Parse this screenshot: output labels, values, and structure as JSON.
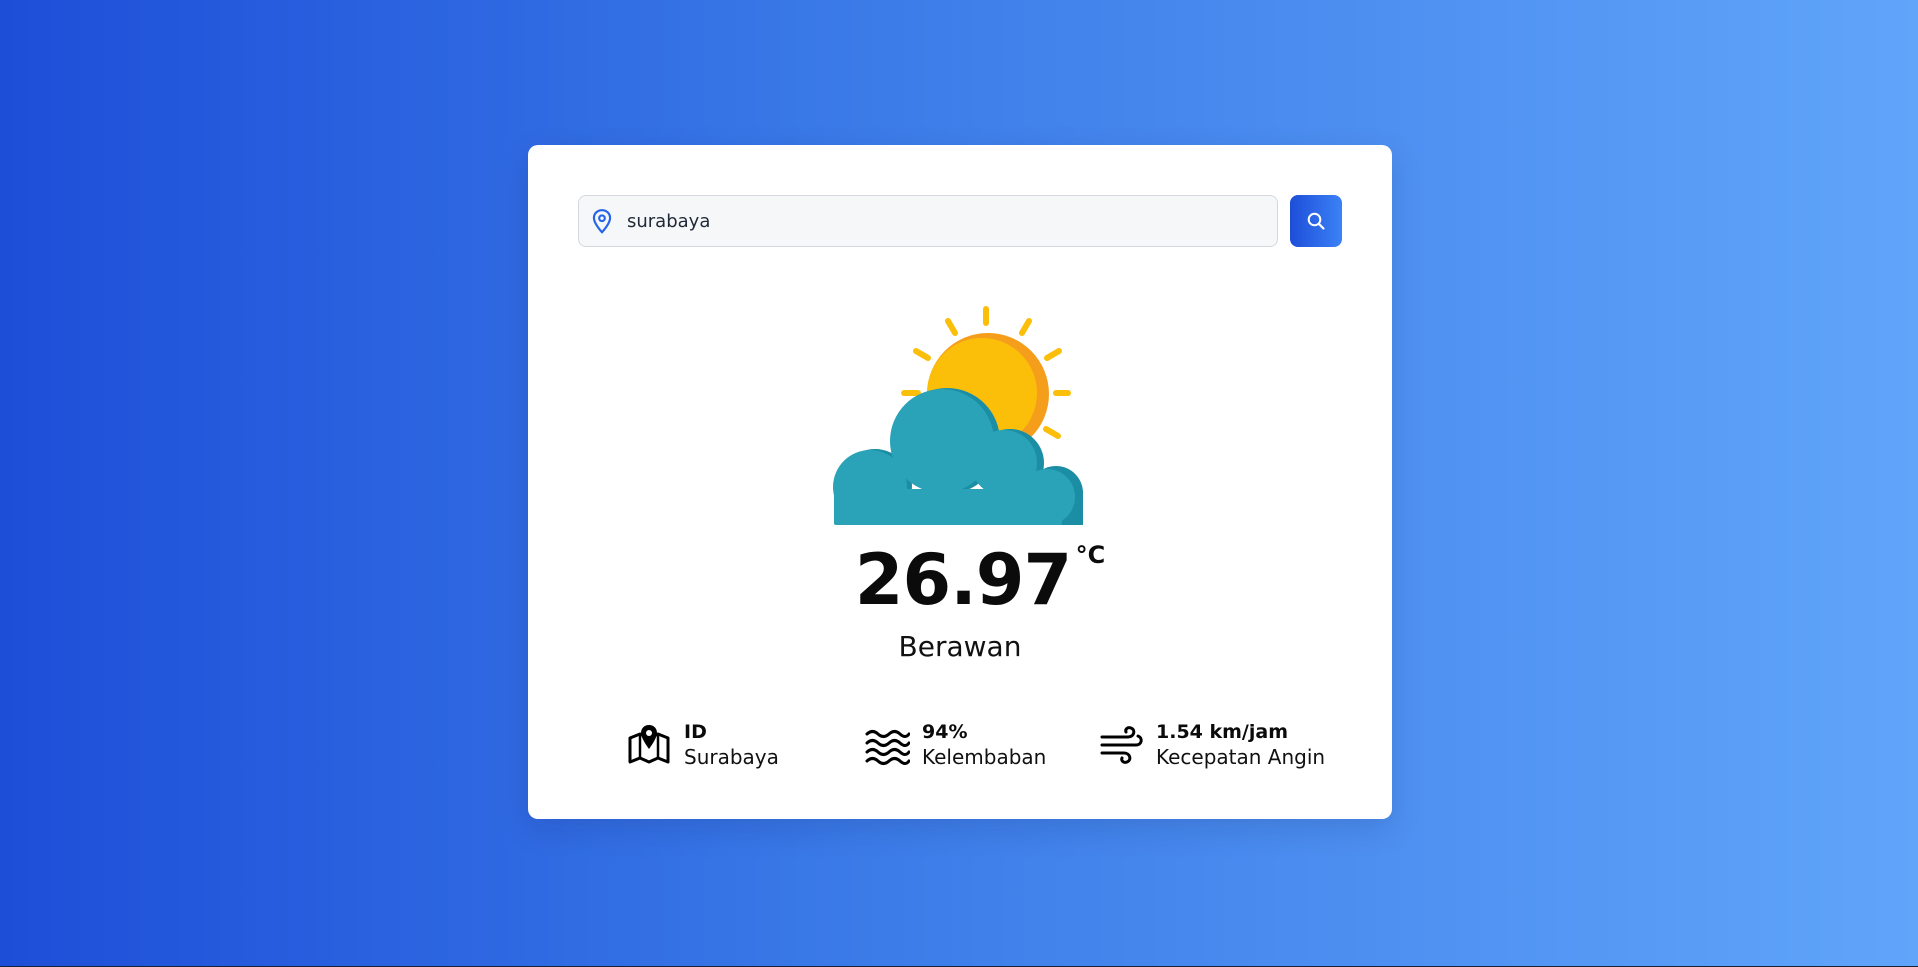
{
  "search": {
    "value": "surabaya",
    "placeholder": ""
  },
  "weather": {
    "temperature": "26.97",
    "unit": "°C",
    "condition": "Berawan",
    "icon": "partly-cloudy-icon"
  },
  "details": [
    {
      "icon": "map-icon",
      "value": "ID",
      "label": "Surabaya"
    },
    {
      "icon": "humidity-waves-icon",
      "value": "94%",
      "label": "Kelembaban"
    },
    {
      "icon": "wind-icon",
      "value": "1.54 km/jam",
      "label": "Kecepatan Angin"
    }
  ],
  "colors": {
    "accent": "#1d4ed8",
    "accent_light": "#3b82f6",
    "sun": "#fbbf0a",
    "sun_shade": "#f59e1b",
    "cloud": "#2aa3b8",
    "cloud_shade": "#1b8ea5"
  }
}
